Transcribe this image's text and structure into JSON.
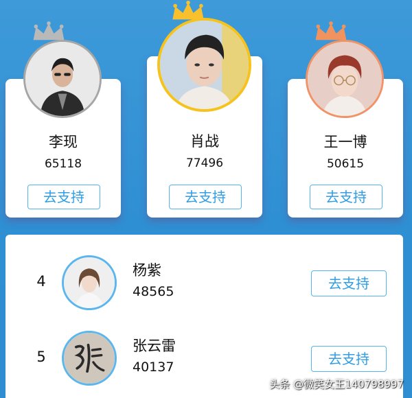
{
  "podium": [
    {
      "rank": 2,
      "name": "李现",
      "score": "65118",
      "button_label": "去支持",
      "ring_color": "#a6a6a6",
      "crown_color": "#b9b9b9"
    },
    {
      "rank": 1,
      "name": "肖战",
      "score": "77496",
      "button_label": "去支持",
      "ring_color": "#f6c21c",
      "crown_color": "#f8c02c"
    },
    {
      "rank": 3,
      "name": "王一博",
      "score": "50615",
      "button_label": "去支持",
      "ring_color": "#f09367",
      "crown_color": "#f1935f"
    }
  ],
  "list": [
    {
      "rank": "4",
      "name": "杨紫",
      "score": "48565",
      "button_label": "去支持"
    },
    {
      "rank": "5",
      "name": "张云雷",
      "score": "40137",
      "button_label": "去支持"
    }
  ],
  "watermark": "头条 @微笑女王140798997",
  "colors": {
    "background": "#3394d6",
    "button_text": "#2f9ee6",
    "button_border": "#52b4ee"
  }
}
